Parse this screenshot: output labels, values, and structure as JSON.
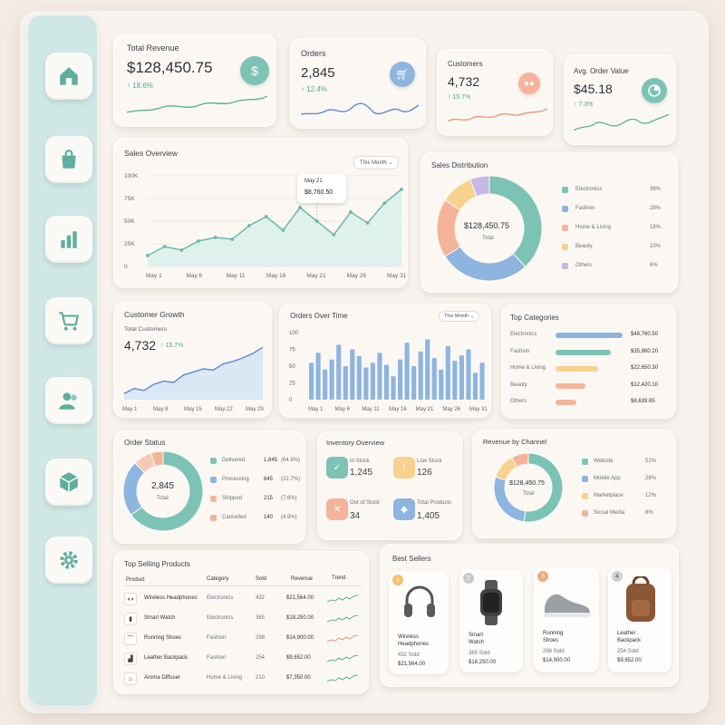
{
  "colors": {
    "teal": "#7cc3b5",
    "blue": "#8eb5df",
    "peach": "#f5b49a",
    "yellow": "#f6d28e",
    "purple": "#c9b8e6",
    "sidebar": "#cfe8e5"
  },
  "sidebar": {
    "items": [
      {
        "icon": "home-icon"
      },
      {
        "icon": "shopping-bag-icon"
      },
      {
        "icon": "bar-chart-icon"
      },
      {
        "icon": "cart-icon"
      },
      {
        "icon": "users-icon"
      },
      {
        "icon": "box-icon"
      },
      {
        "icon": "gear-icon"
      }
    ]
  },
  "kpis": [
    {
      "label": "Total Revenue",
      "value": "$128,450.75",
      "change": "↑ 18.6%",
      "icon": "dollar-icon"
    },
    {
      "label": "Orders",
      "value": "2,845",
      "change": "↑ 12.4%",
      "icon": "cart-icon"
    },
    {
      "label": "Customers",
      "value": "4,732",
      "change": "↑ 15.7%",
      "icon": "users-icon"
    },
    {
      "label": "Avg. Order Value",
      "value": "$45.18",
      "change": "↑ 7.3%",
      "icon": "pie-chart-icon"
    }
  ],
  "sales_overview": {
    "title": "Sales Overview",
    "filter": "This Month",
    "tooltip_date": "May 21",
    "tooltip_value": "$8,760.50",
    "yticks": [
      "100K",
      "75K",
      "50K",
      "25K",
      "0"
    ],
    "xticks": [
      "May 1",
      "May 6",
      "May 11",
      "May 16",
      "May 21",
      "May 26",
      "May 31"
    ]
  },
  "sales_distribution": {
    "title": "Sales Distribution",
    "center_value": "$128,450.75",
    "center_label": "Total",
    "items": [
      {
        "name": "Electronics",
        "pct": "38%",
        "value": 38
      },
      {
        "name": "Fashion",
        "pct": "28%",
        "value": 28
      },
      {
        "name": "Home & Living",
        "pct": "18%",
        "value": 18
      },
      {
        "name": "Beauty",
        "pct": "10%",
        "value": 10
      },
      {
        "name": "Others",
        "pct": "6%",
        "value": 6
      }
    ]
  },
  "customer_growth": {
    "title": "Customer Growth",
    "subtitle": "Total Customers",
    "value": "4,732",
    "change": "↑ 15.7%",
    "xticks": [
      "May 1",
      "May 8",
      "May 15",
      "May 22",
      "May 29"
    ]
  },
  "orders_over_time": {
    "title": "Orders Over Time",
    "filter": "This Month",
    "yticks": [
      "100",
      "75",
      "50",
      "25",
      "0"
    ],
    "xticks": [
      "May 1",
      "May 6",
      "May 11",
      "May 16",
      "May 21",
      "May 26",
      "May 31"
    ]
  },
  "top_categories": {
    "title": "Top Categories",
    "items": [
      {
        "name": "Electronics",
        "value": "$48,760.50",
        "pct": 0.95
      },
      {
        "name": "Fashion",
        "value": "$35,980.20",
        "pct": 0.78
      },
      {
        "name": "Home & Living",
        "value": "$22,650.30",
        "pct": 0.6
      },
      {
        "name": "Beauty",
        "value": "$12,420.10",
        "pct": 0.42
      },
      {
        "name": "Others",
        "value": "$8,639.65",
        "pct": 0.3
      }
    ]
  },
  "order_status": {
    "title": "Order Status",
    "center_value": "2,845",
    "center_label": "Total",
    "items": [
      {
        "name": "Delivered",
        "count": "1,845",
        "pct": "(64.8%)",
        "value": 64.8
      },
      {
        "name": "Processing",
        "count": "645",
        "pct": "(22.7%)",
        "value": 22.7
      },
      {
        "name": "Shipped",
        "count": "215",
        "pct": "(7.6%)",
        "value": 7.6
      },
      {
        "name": "Cancelled",
        "count": "140",
        "pct": "(4.9%)",
        "value": 4.9
      }
    ]
  },
  "inventory": {
    "title": "Inventory Overview",
    "items": [
      {
        "label": "In Stock",
        "value": "1,245",
        "icon": "check-icon"
      },
      {
        "label": "Low Stock",
        "value": "126",
        "icon": "warning-icon"
      },
      {
        "label": "Out of Stock",
        "value": "34",
        "icon": "x-box-icon"
      },
      {
        "label": "Total Products",
        "value": "1,405",
        "icon": "cube-icon"
      }
    ]
  },
  "revenue_channel": {
    "title": "Revenue by Channel",
    "center_value": "$128,450.75",
    "center_label": "Total",
    "items": [
      {
        "name": "Website",
        "pct": "52%",
        "value": 52
      },
      {
        "name": "Mobile App",
        "pct": "28%",
        "value": 28
      },
      {
        "name": "Marketplace",
        "pct": "12%",
        "value": 12
      },
      {
        "name": "Social Media",
        "pct": "8%",
        "value": 8
      }
    ]
  },
  "top_products": {
    "title": "Top Selling Products",
    "headers": [
      "Product",
      "Category",
      "Sold",
      "Revenue",
      "Trend"
    ],
    "rows": [
      {
        "name": "Wireless Headphones",
        "category": "Electronics",
        "sold": "432",
        "revenue": "$21,564.00",
        "icon": "headphones-icon"
      },
      {
        "name": "Smart Watch",
        "category": "Electronics",
        "sold": "365",
        "revenue": "$18,250.00",
        "icon": "watch-icon"
      },
      {
        "name": "Running Shoes",
        "category": "Fashion",
        "sold": "298",
        "revenue": "$14,900.00",
        "icon": "shoe-icon"
      },
      {
        "name": "Leather Backpack",
        "category": "Fashion",
        "sold": "254",
        "revenue": "$9,652.00",
        "icon": "backpack-icon"
      },
      {
        "name": "Aroma Diffuser",
        "category": "Home & Living",
        "sold": "210",
        "revenue": "$7,350.00",
        "icon": "diffuser-icon"
      }
    ]
  },
  "best_sellers": {
    "title": "Best Sellers",
    "items": [
      {
        "rank": "1",
        "name1": "Wireless",
        "name2": "Headphones",
        "sold": "432 Sold",
        "revenue": "$21,564.00"
      },
      {
        "rank": "2",
        "name1": "Smart",
        "name2": "Watch",
        "sold": "365 Sold",
        "revenue": "$18,250.00"
      },
      {
        "rank": "3",
        "name1": "Running",
        "name2": "Shoes",
        "sold": "298 Sold",
        "revenue": "$14,900.00"
      },
      {
        "rank": "4",
        "name1": "Leather",
        "name2": "Backpack",
        "sold": "254 Sold",
        "revenue": "$9,652.00"
      }
    ]
  },
  "chart_data": [
    {
      "type": "line",
      "title": "Sales Overview",
      "x": [
        "May 1",
        "May 3",
        "May 5",
        "May 7",
        "May 9",
        "May 11",
        "May 13",
        "May 15",
        "May 17",
        "May 19",
        "May 21",
        "May 23",
        "May 25",
        "May 27",
        "May 29",
        "May 31"
      ],
      "values": [
        12,
        22,
        18,
        28,
        32,
        30,
        45,
        55,
        40,
        65,
        50,
        35,
        60,
        48,
        70,
        85
      ],
      "ylim": [
        0,
        100
      ]
    },
    {
      "type": "bar",
      "title": "Orders Over Time",
      "values": [
        55,
        70,
        45,
        60,
        82,
        50,
        75,
        65,
        48,
        55,
        70,
        52,
        35,
        60,
        85,
        50,
        72,
        90,
        62,
        45,
        80,
        58,
        66,
        75,
        40,
        55
      ],
      "ylim": [
        0,
        100
      ]
    },
    {
      "type": "area",
      "title": "Customer Growth",
      "values": [
        10,
        18,
        15,
        25,
        30,
        28,
        40,
        45,
        50,
        48,
        58,
        62,
        68,
        75,
        85
      ],
      "ylim": [
        0,
        100
      ]
    }
  ]
}
